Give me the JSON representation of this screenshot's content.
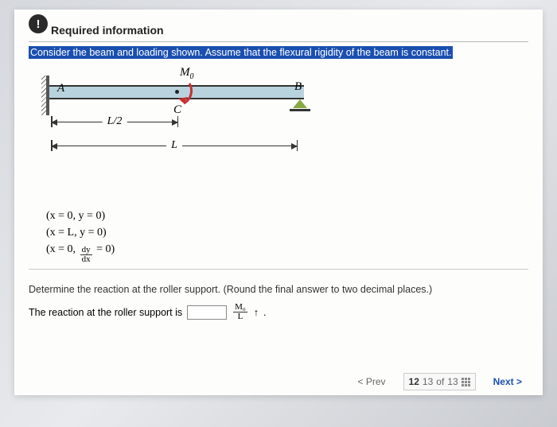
{
  "header": {
    "title": "Required information",
    "instruction": "Consider the beam and loading shown. Assume that the flexural rigidity of the beam is constant."
  },
  "diagram": {
    "labels": {
      "A": "A",
      "B": "B",
      "C": "C",
      "M0": "M",
      "M0_sub": "0"
    },
    "dims": {
      "half": "L/2",
      "full": "L"
    }
  },
  "equations": {
    "e1": "(x = 0, y = 0)",
    "e2": "(x = L, y = 0)",
    "e3_open": "(x = 0, ",
    "e3_num": "dy",
    "e3_den": "dx",
    "e3_close": " = 0)"
  },
  "question": {
    "prompt": "Determine the reaction at the roller support. (Round the final answer to two decimal places.)",
    "answer_prefix": "The reaction at the roller support is",
    "unit_num": "M₀",
    "unit_den": "L",
    "arrow": "↑",
    "period": "."
  },
  "nav": {
    "prev": "Prev",
    "next": "Next",
    "current": "12",
    "visible_next_num": "13",
    "of": "of",
    "total": "13"
  }
}
